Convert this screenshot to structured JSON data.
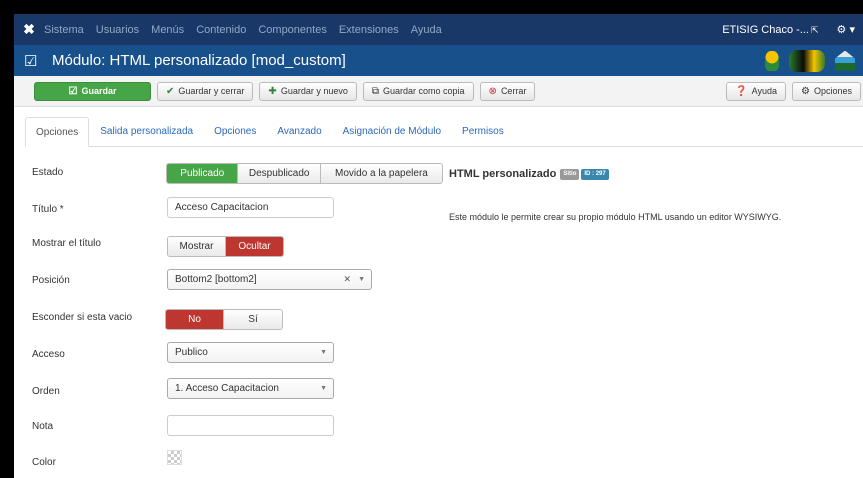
{
  "navbar": {
    "menu": [
      "Sistema",
      "Usuarios",
      "Menús",
      "Contenido",
      "Componentes",
      "Extensiones",
      "Ayuda"
    ],
    "site_name": "ETISIG Chaco -...",
    "external_icon": "⇱",
    "settings_icon": "⚙ ▾"
  },
  "titlebar": {
    "check_icon": "☑",
    "title": "Módulo: HTML personalizado [mod_custom]"
  },
  "toolbar": {
    "save": "Guardar",
    "save_close": "Guardar y cerrar",
    "save_new": "Guardar y nuevo",
    "save_copy": "Guardar como copia",
    "close": "Cerrar",
    "help": "Ayuda",
    "options": "Opciones"
  },
  "tabs": [
    "Opciones",
    "Salida personalizada",
    "Opciones",
    "Avanzado",
    "Asignación de Módulo",
    "Permisos"
  ],
  "form": {
    "estado": {
      "label": "Estado",
      "options": [
        "Publicado",
        "Despublicado",
        "Movido a la papelera"
      ]
    },
    "titulo": {
      "label": "Título *",
      "value": "Acceso Capacitacion"
    },
    "mostrar_titulo": {
      "label": "Mostrar el título",
      "options": [
        "Mostrar",
        "Ocultar"
      ]
    },
    "posicion": {
      "label": "Posición",
      "value": "Bottom2 [bottom2]"
    },
    "esconder": {
      "label": "Esconder si esta vacio",
      "options": [
        "No",
        "Sí"
      ]
    },
    "acceso": {
      "label": "Acceso",
      "value": "Publico"
    },
    "orden": {
      "label": "Orden",
      "value": "1. Acceso Capacitacion"
    },
    "nota": {
      "label": "Nota",
      "value": ""
    },
    "color": {
      "label": "Color"
    }
  },
  "module_info": {
    "name": "HTML personalizado",
    "badge_site": "Sitio",
    "badge_id": "ID : 297",
    "description": "Este módulo le permite crear su propio módulo HTML usando un editor WYSIWYG."
  },
  "colors": {
    "navbar": "#1a3867",
    "titlebar": "#17508b",
    "green": "#46a546",
    "red": "#bd362f",
    "link": "#2a69b8"
  }
}
